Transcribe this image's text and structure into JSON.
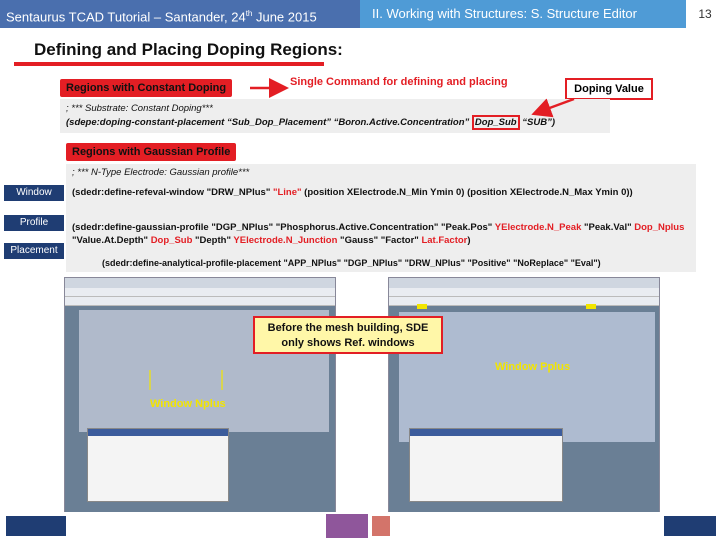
{
  "header": {
    "left_title": "Sentaurus TCAD Tutorial – Santander, 24",
    "left_sup": "th",
    "left_suffix": " June 2015",
    "section": "II. Working with Structures: S. Structure Editor",
    "slide_number": "13"
  },
  "title": "Defining and Placing Doping Regions:",
  "constant": {
    "tag": "Regions with Constant Doping",
    "callout": "Single Command for defining and placing",
    "doping_value_label": "Doping Value",
    "comment": "; *** Substrate: Constant Doping***",
    "command_prefix": "(sdepe:doping-constant-placement “Sub_Dop_Placement” “Boron.Active.Concentration” ",
    "command_highlight": "Dop_Sub",
    "command_suffix": " “SUB”)"
  },
  "gaussian": {
    "tag": "Regions with Gaussian Profile",
    "comment": "; *** N-Type Electrode: Gaussian profile***",
    "labels": {
      "window": "Window",
      "profile": "Profile",
      "placement": "Placement"
    },
    "window_cmd": {
      "a": "(sdedr:define-refeval-window \"DRW_NPlus\" ",
      "b": "\"Line\"",
      "c": " (position XElectrode.N_Min Ymin 0) (position XElectrode.N_Max Ymin 0))"
    },
    "profile_cmd": {
      "a": "(sdedr:define-gaussian-profile \"DGP_NPlus\" \"Phosphorus.Active.Concentration\" \"Peak.Pos\" ",
      "b": "YElectrode.N_Peak",
      "c": " \"Peak.Val\" ",
      "d": "Dop_Nplus",
      "e": " \"Value.At.Depth\" ",
      "f": "Dop_Sub",
      "g": " \"Depth\" ",
      "h": "YElectrode.N_Junction",
      "i": " \"Gauss\" \"Factor\" ",
      "j": "Lat.Factor",
      "k": ")"
    },
    "placement_cmd": "(sdedr:define-analytical-profile-placement \"APP_NPlus\" \"DGP_NPlus\" \"DRW_NPlus\" \"Positive\" \"NoReplace\" \"Eval\")"
  },
  "screenshots": {
    "note": "Before the mesh building, SDE only shows Ref. windows",
    "window_nplus": "Window Nplus",
    "window_pplus": "Window Pplus"
  },
  "colors": {
    "accent_red": "#e31e24",
    "header_dark": "#4a6fae",
    "header_light": "#4f9bd6",
    "label_navy": "#1f3d73",
    "yellow": "#f2e500"
  }
}
